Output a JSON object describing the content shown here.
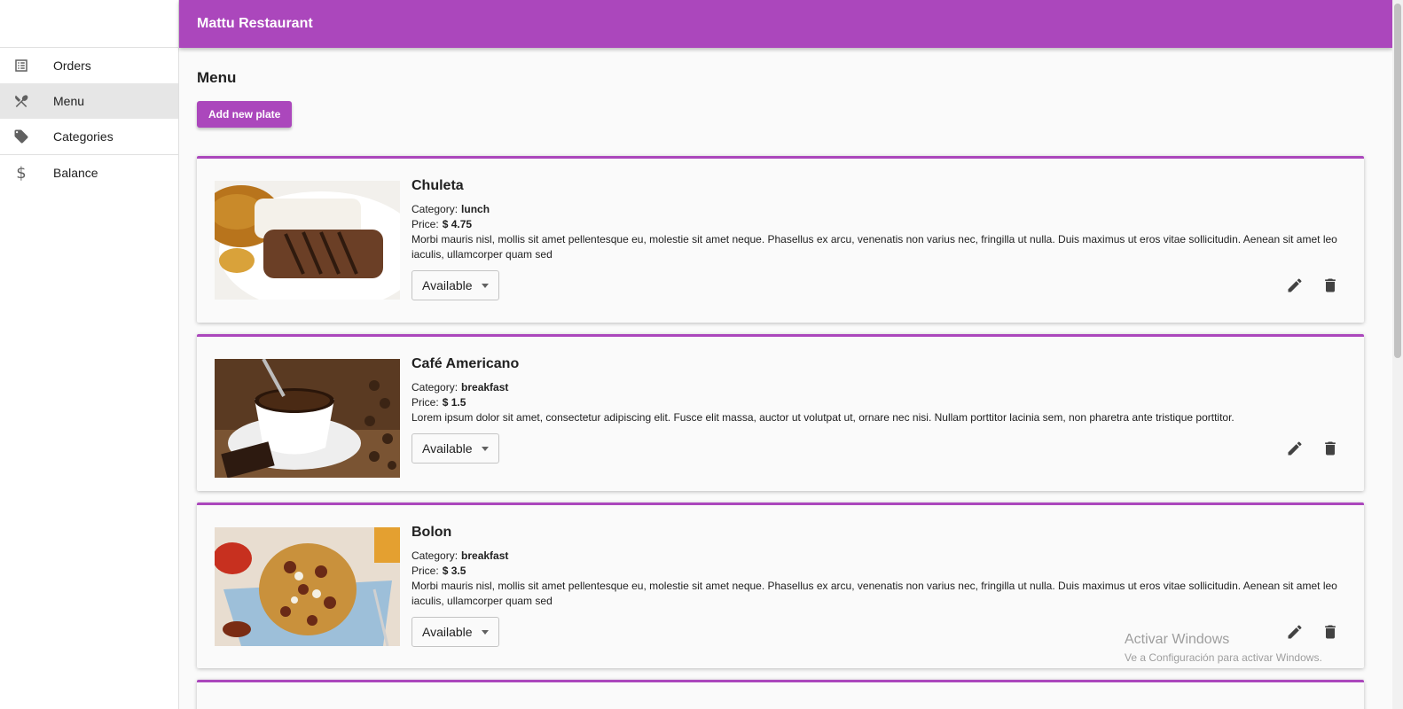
{
  "app": {
    "title": "Mattu Restaurant"
  },
  "colors": {
    "primary": "#ab47bc",
    "sidebar_active": "#e6e6e6"
  },
  "sidebar": {
    "items": [
      {
        "label": "Orders",
        "icon": "list-icon"
      },
      {
        "label": "Menu",
        "icon": "fork-knife-icon",
        "active": true
      },
      {
        "label": "Categories",
        "icon": "tag-icon"
      },
      {
        "label": "Balance",
        "icon": "dollar-icon",
        "glyph": "$"
      }
    ]
  },
  "main": {
    "title": "Menu",
    "add_button": "Add new plate",
    "category_label": "Category:",
    "price_label": "Price:",
    "plates": [
      {
        "name": "Chuleta",
        "category": "lunch",
        "price": "$ 4.75",
        "description": "Morbi mauris nisl, mollis sit amet pellentesque eu, molestie sit amet neque. Phasellus ex arcu, venenatis non varius nec, fringilla ut nulla. Duis maximus ut eros vitae sollicitudin. Aenean sit amet leo iaculis, ullamcorper quam sed",
        "status": "Available",
        "image": "pork-chop-with-rice-photo"
      },
      {
        "name": "Café Americano",
        "category": "breakfast",
        "price": "$ 1.5",
        "description": "Lorem ipsum dolor sit amet, consectetur adipiscing elit. Fusce elit massa, auctor ut volutpat ut, ornare nec nisi. Nullam porttitor lacinia sem, non pharetra ante tristique porttitor.",
        "status": "Available",
        "image": "coffee-cup-photo"
      },
      {
        "name": "Bolon",
        "category": "breakfast",
        "price": "$ 3.5",
        "description": "Morbi mauris nisl, mollis sit amet pellentesque eu, molestie sit amet neque. Phasellus ex arcu, venenatis non varius nec, fringilla ut nulla. Duis maximus ut eros vitae sollicitudin. Aenean sit amet leo iaculis, ullamcorper quam sed",
        "status": "Available",
        "image": "bolon-plantain-ball-photo"
      }
    ]
  },
  "watermark": {
    "title": "Activar Windows",
    "subtitle": "Ve a Configuración para activar Windows."
  }
}
